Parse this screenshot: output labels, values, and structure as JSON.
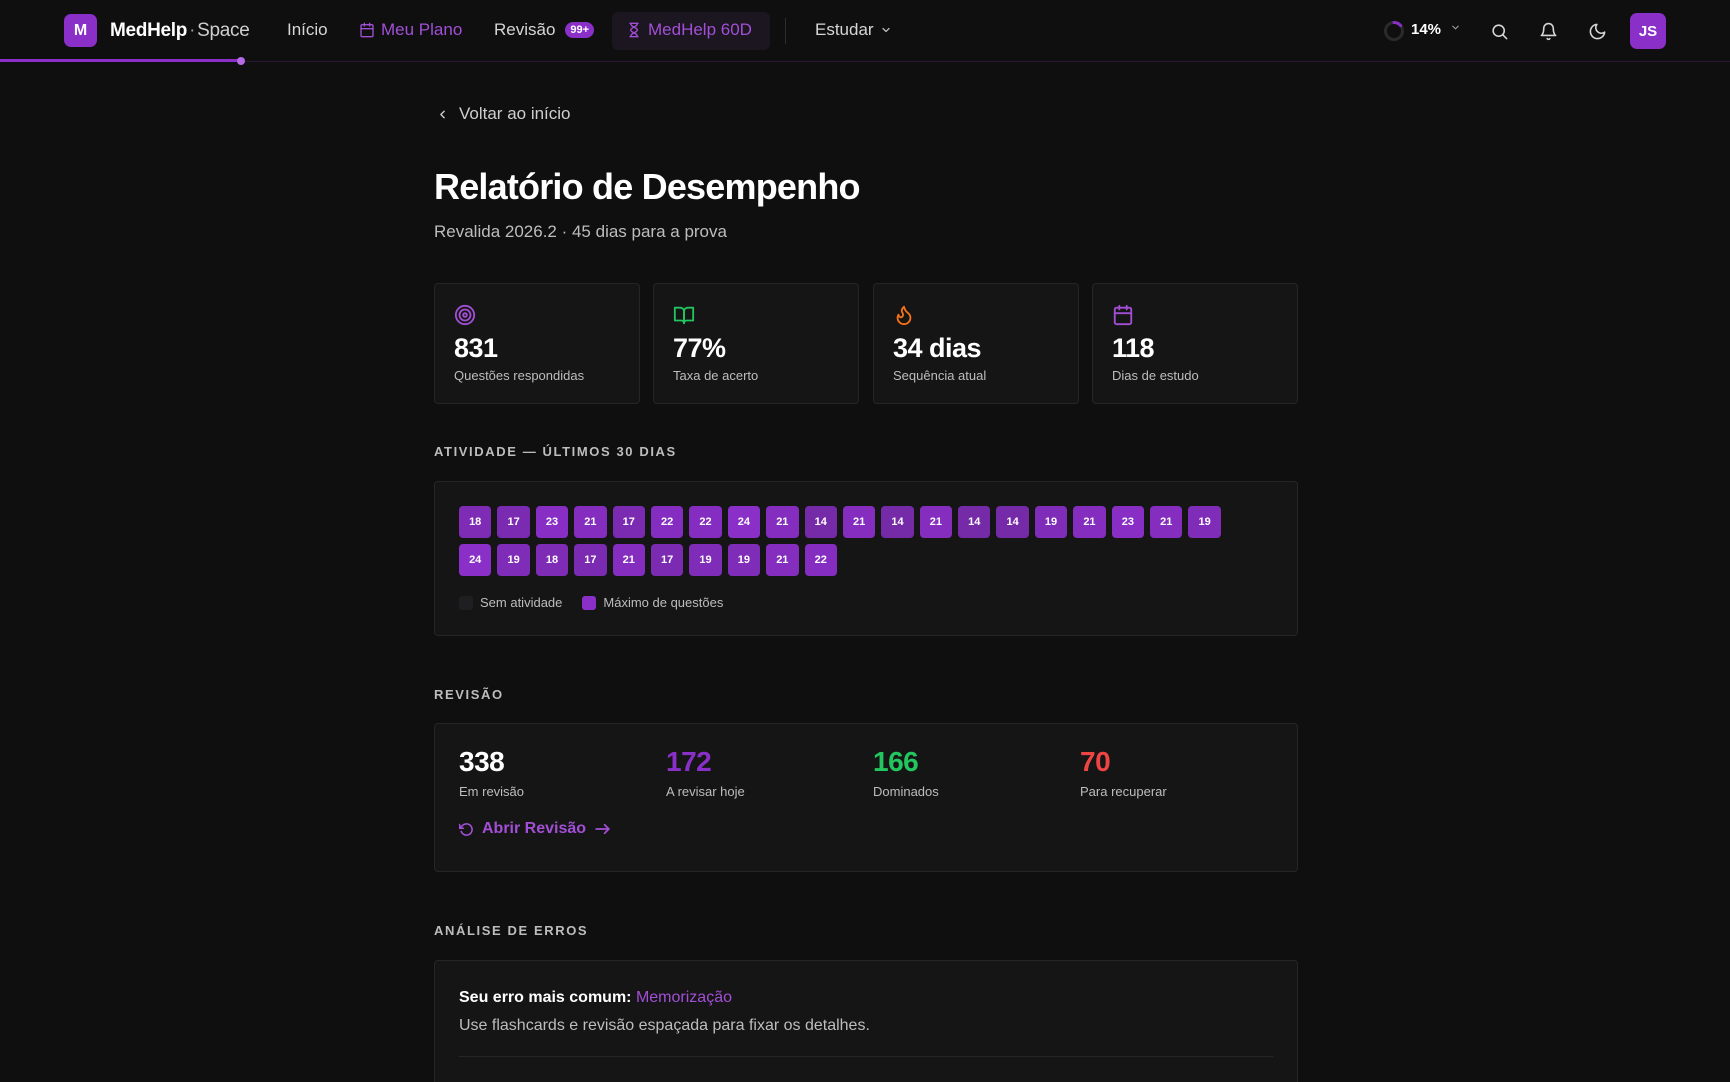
{
  "brand": {
    "logo_letter": "M",
    "name_bold": "MedHelp",
    "separator": "·",
    "name_light": "Space"
  },
  "nav": {
    "inicio": "Início",
    "meu_plano": "Meu Plano",
    "revisao": "Revisão",
    "revisao_badge": "99+",
    "medhelp60d": "MedHelp 60D",
    "estudar": "Estudar"
  },
  "header_right": {
    "progress": "14%",
    "progress_value": 0.14,
    "avatar": "JS"
  },
  "back": "Voltar ao início",
  "title": "Relatório de Desempenho",
  "subtitle": "Revalida 2026.2 · 45 dias para a prova",
  "stats": [
    {
      "value": "831",
      "label": "Questões respondidas",
      "icon": "target-icon"
    },
    {
      "value": "77%",
      "label": "Taxa de acerto",
      "icon": "book-open-icon"
    },
    {
      "value": "34 dias",
      "label": "Sequência atual",
      "icon": "flame-icon"
    },
    {
      "value": "118",
      "label": "Dias de estudo",
      "icon": "calendar-icon"
    }
  ],
  "activity": {
    "heading": "ATIVIDADE — ÚLTIMOS 30 DIAS",
    "days": [
      18,
      17,
      23,
      21,
      17,
      22,
      22,
      24,
      21,
      14,
      21,
      14,
      21,
      14,
      14,
      19,
      21,
      23,
      21,
      19,
      24,
      19,
      18,
      17,
      21,
      17,
      19,
      19,
      21,
      22
    ],
    "legend_none": "Sem atividade",
    "legend_max": "Máximo de questões"
  },
  "review": {
    "heading": "REVISÃO",
    "stats": [
      {
        "value": "338",
        "label": "Em revisão",
        "color": "#ffffff"
      },
      {
        "value": "172",
        "label": "A revisar hoje",
        "color": "#8b2fc9"
      },
      {
        "value": "166",
        "label": "Dominados",
        "color": "#22c55e"
      },
      {
        "value": "70",
        "label": "Para recuperar",
        "color": "#ef4444"
      }
    ],
    "open_label": "Abrir Revisão"
  },
  "errors": {
    "heading": "ANÁLISE DE ERROS",
    "common_label": "Seu erro mais comum:",
    "common_value": "Memorização",
    "tip": "Use flashcards e revisão espaçada para fixar os detalhes."
  },
  "colors": {
    "accent": "#8b2fc9",
    "accent_light": "#a24fd6",
    "background": "#0f0f10"
  }
}
